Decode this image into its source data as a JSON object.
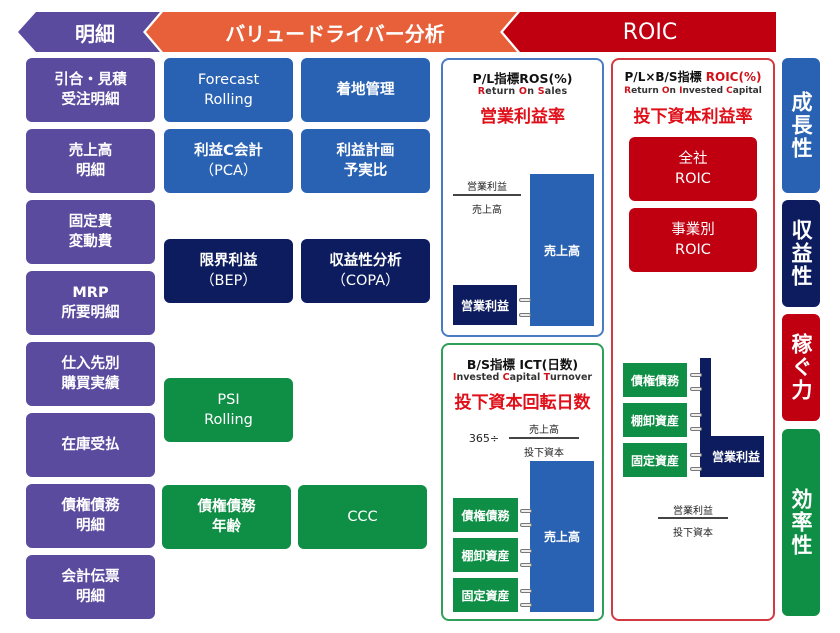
{
  "header": {
    "meisai": "明細",
    "value_driver": "バリュードライバー分析",
    "roic": "ROIC"
  },
  "detail_items": [
    {
      "line1": "引合・見積",
      "line2": "受注明細"
    },
    {
      "line1": "売上高",
      "line2": "明細"
    },
    {
      "line1": "固定費",
      "line2": "変動費"
    },
    {
      "line1": "MRP",
      "line2": "所要明細"
    },
    {
      "line1": "仕入先別",
      "line2": "購買実績"
    },
    {
      "line1": "在庫受払",
      "line2": ""
    },
    {
      "line1": "債権債務",
      "line2": "明細"
    },
    {
      "line1": "会計伝票",
      "line2": "明細"
    }
  ],
  "driver_items": {
    "forecast": {
      "line1": "Forecast",
      "line2": "Rolling"
    },
    "landing": {
      "line1": "着地管理",
      "line2": ""
    },
    "pca": {
      "line1": "利益C会計",
      "line2": "（PCA）"
    },
    "plan": {
      "line1": "利益計画",
      "line2": "予実比"
    },
    "bep": {
      "line1": "限界利益",
      "line2": "（BEP）"
    },
    "copa": {
      "line1": "収益性分析",
      "line2": "（COPA）"
    },
    "psi": {
      "line1": "PSI",
      "line2": "Rolling"
    },
    "aging": {
      "line1": "債権債務",
      "line2": "年齢"
    },
    "ccc": {
      "line1": "CCC",
      "line2": ""
    }
  },
  "ros_panel": {
    "title": "P/L指標ROS(%)",
    "sub": {
      "parts": [
        [
          "R",
          "eturn "
        ],
        [
          "O",
          "n "
        ],
        [
          "S",
          "ales"
        ]
      ]
    },
    "jp": "営業利益率",
    "numerator": "営業利益",
    "denominator": "売上高",
    "bar_small": "営業利益",
    "bar_large": "売上高"
  },
  "ict_panel": {
    "title": "B/S指標 ICT(日数)",
    "sub": {
      "parts": [
        [
          "I",
          "nvested "
        ],
        [
          "C",
          "apital "
        ],
        [
          "T",
          "urnover"
        ]
      ]
    },
    "jp": "投下資本回転日数",
    "prefix": "365÷",
    "numerator": "売上高",
    "denominator": "投下資本",
    "bars": [
      "債権債務",
      "棚卸資産",
      "固定資産"
    ],
    "bar_large": "売上高"
  },
  "roic_panel": {
    "title_black": "P/L×B/S指標 ",
    "title_red": "ROIC(%)",
    "sub": {
      "parts": [
        [
          "R",
          "eturn "
        ],
        [
          "O",
          "n "
        ],
        [
          "I",
          "nvested "
        ],
        [
          "C",
          "apital"
        ]
      ]
    },
    "jp": "投下資本利益率",
    "company": {
      "line1": "全社",
      "line2": "ROIC"
    },
    "segment": {
      "line1": "事業別",
      "line2": "ROIC"
    },
    "bars": [
      "債権債務",
      "棚卸資産",
      "固定資産"
    ],
    "profit": "営業利益",
    "numerator": "営業利益",
    "denominator": "投下資本"
  },
  "side_labels": [
    "成長性",
    "収益性",
    "稼ぐ力",
    "効率性"
  ],
  "colors": {
    "purple": "#5a4b9e",
    "orange": "#e8603a",
    "red": "#c00010",
    "blue": "#2a62b3",
    "navy": "#0d1c5e",
    "green": "#0f8f45"
  }
}
